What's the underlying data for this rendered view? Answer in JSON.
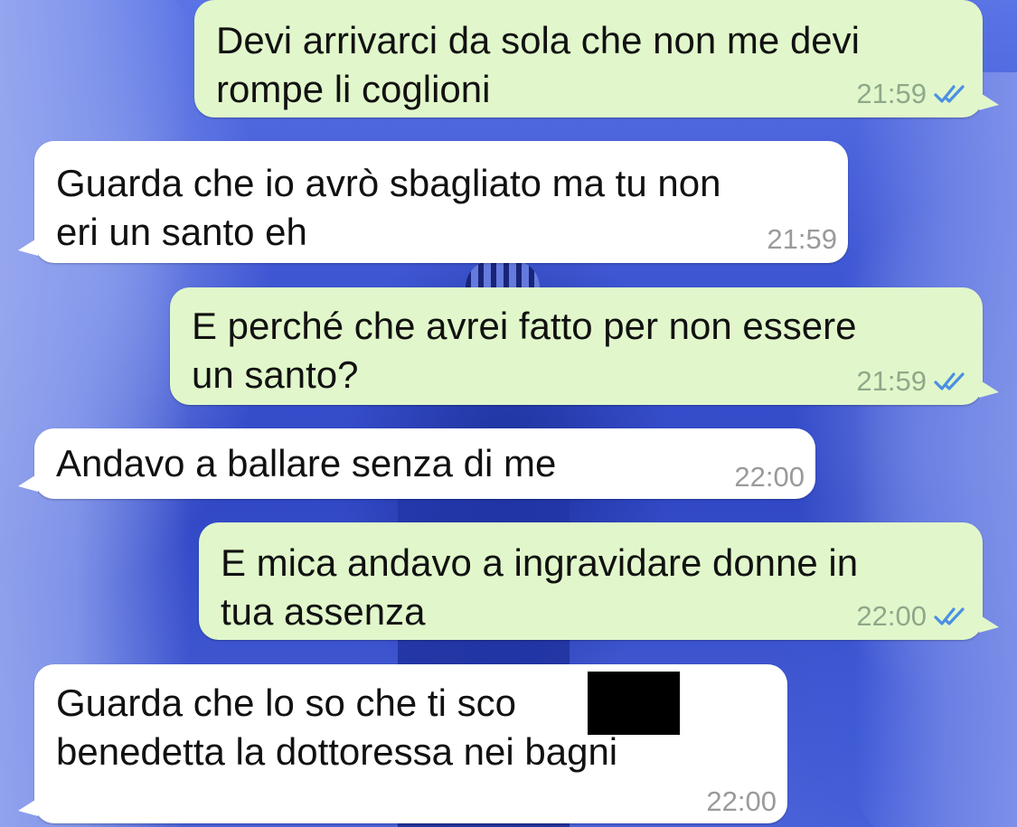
{
  "chat": {
    "messages": [
      {
        "direction": "out",
        "text": "Devi arrivarci da sola che non me devi\nrompe li coglioni",
        "time": "21:59",
        "status": "double-check-read"
      },
      {
        "direction": "in",
        "text": "Guarda che io avrò sbagliato ma tu non\neri un santo eh",
        "time": "21:59"
      },
      {
        "direction": "out",
        "text": "E perché che avrei fatto per non essere\nun santo?",
        "time": "21:59",
        "status": "double-check-read"
      },
      {
        "direction": "in",
        "text": "Andavo a ballare senza di me",
        "time": "22:00"
      },
      {
        "direction": "out",
        "text": "E mica andavo a ingravidare donne in\ntua assenza",
        "time": "22:00",
        "status": "double-check-read"
      },
      {
        "direction": "in",
        "text": "Guarda che lo so che ti sco\nbenedetta la dottoressa nei bagni",
        "time": "22:00",
        "redacted": true
      }
    ]
  },
  "colors": {
    "outgoing_bubble": "#e1f7cb",
    "incoming_bubble": "#ffffff",
    "read_ticks": "#4a90e2",
    "timestamp": "#9a9a9a",
    "wallpaper": "#3d55d2"
  },
  "icons": {
    "read_receipt": "double-check-icon"
  }
}
